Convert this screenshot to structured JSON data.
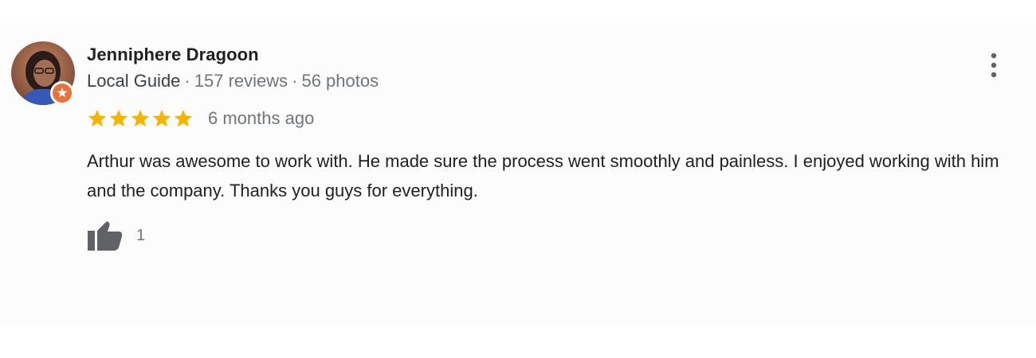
{
  "review": {
    "author": {
      "name": "Jenniphere Dragoon",
      "badge": "Local Guide",
      "reviews_count": "157 reviews",
      "photos_count": "56 photos",
      "separator": "·",
      "avatar_icon": "user-avatar-photo",
      "badge_icon": "local-guide-star-icon"
    },
    "rating": {
      "stars": 5,
      "max_stars": 5,
      "star_color": "#f4b400"
    },
    "age": "6 months ago",
    "text": "Arthur was awesome to work with. He made sure the process went smoothly and painless. I enjoyed working with him and the company. Thanks you guys for everything.",
    "likes": {
      "count": "1",
      "icon": "thumbs-up-icon"
    },
    "menu_icon": "more-vert-icon"
  },
  "colors": {
    "text_primary": "#202124",
    "text_secondary": "#70757a",
    "icon_gray": "#5f6368",
    "local_guide_orange": "#e8713c"
  }
}
